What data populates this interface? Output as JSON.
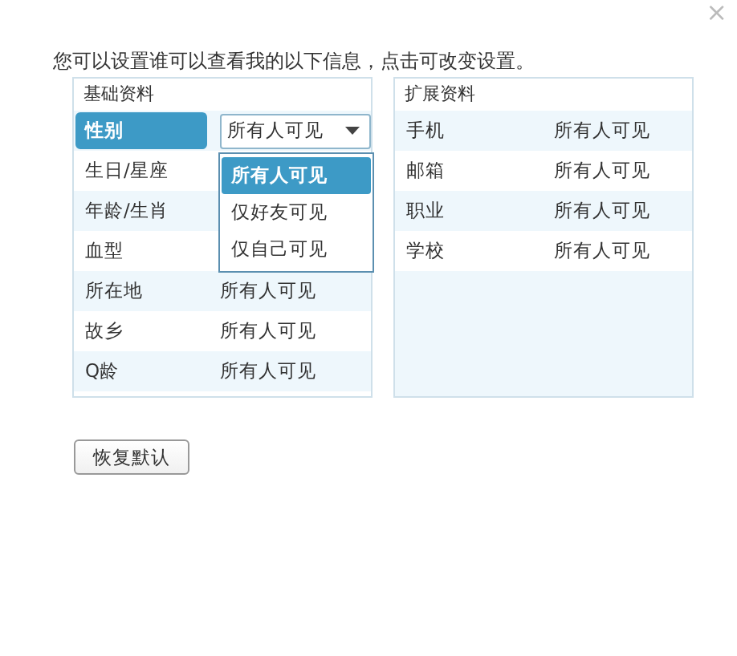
{
  "close_label": "×",
  "intro": "您可以设置谁可以查看我的以下信息，点击可改变设置。",
  "basic": {
    "title": "基础资料",
    "rows": [
      {
        "label": "性别",
        "value": "所有人可见",
        "selected": true
      },
      {
        "label": "生日/星座",
        "selected": false
      },
      {
        "label": "年龄/生肖",
        "selected": false
      },
      {
        "label": "血型",
        "selected": false
      },
      {
        "label": "所在地",
        "value": "所有人可见",
        "selected": false
      },
      {
        "label": "故乡",
        "value": "所有人可见",
        "selected": false
      },
      {
        "label": "Q龄",
        "value": "所有人可见",
        "selected": false
      }
    ]
  },
  "dropdown": {
    "expanded": true,
    "options": [
      {
        "label": "所有人可见",
        "selected": true
      },
      {
        "label": "仅好友可见",
        "selected": false
      },
      {
        "label": "仅自己可见",
        "selected": false
      }
    ]
  },
  "extended": {
    "title": "扩展资料",
    "rows": [
      {
        "label": "手机",
        "value": "所有人可见"
      },
      {
        "label": "邮箱",
        "value": "所有人可见"
      },
      {
        "label": "职业",
        "value": "所有人可见"
      },
      {
        "label": "学校",
        "value": "所有人可见"
      }
    ]
  },
  "reset_button": "恢复默认"
}
